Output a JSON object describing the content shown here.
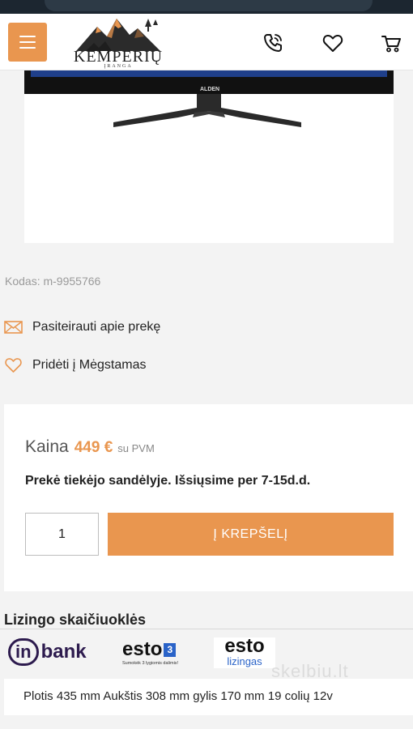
{
  "header": {
    "logo_text": "KEMPERIŲ",
    "logo_subtext": "ĮRANGA",
    "icons": [
      "menu-icon",
      "phone-icon",
      "heart-icon",
      "cart-icon"
    ]
  },
  "product": {
    "image_brand": "ALDEN",
    "code_label": "Kodas: m-9955766"
  },
  "actions": {
    "inquire_label": "Pasiteirauti apie prekę",
    "favorite_label": "Pridėti į Mėgstamas"
  },
  "price": {
    "label": "Kaina",
    "value": "449 €",
    "vat_note": "su PVM",
    "stock_note": "Prekė tiekėjo sandėlyje. Išsiųsime per 7-15d.d.",
    "quantity": "1",
    "add_to_cart_label": "Į KREPŠELĮ"
  },
  "leasing": {
    "title": "Lizingo skaičiuoklės",
    "lenders": [
      {
        "prefix": "in",
        "name": "bank"
      },
      {
        "name": "esto",
        "badge": "3",
        "sub": "Sumokėk 3 lygiomis dalimis!"
      },
      {
        "name": "esto",
        "sub": "lizingas"
      }
    ]
  },
  "specs": {
    "text": "Plotis 435 mm Aukštis 308 mm gylis 170 mm 19 colių 12v"
  },
  "watermark": "skelbiu.lt",
  "colors": {
    "accent": "#e9964f",
    "text": "#222222",
    "muted": "#9a9a9a"
  }
}
